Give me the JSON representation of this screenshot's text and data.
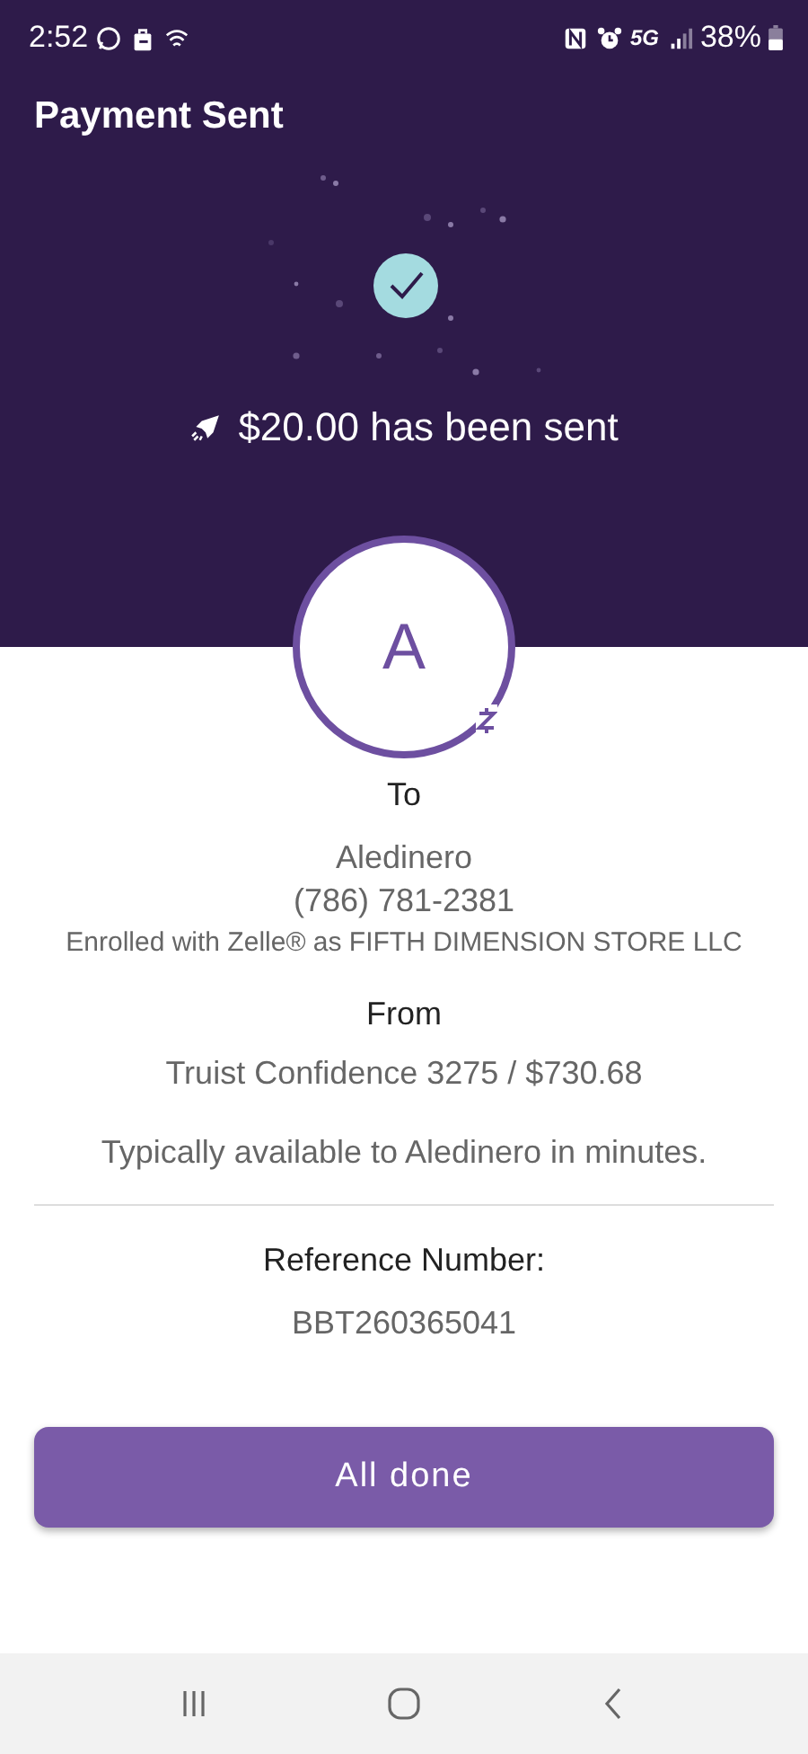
{
  "status_bar": {
    "time": "2:52",
    "network": "5G",
    "battery": "38%"
  },
  "header": {
    "title": "Payment Sent",
    "message": "$20.00 has been sent"
  },
  "recipient": {
    "initial": "A",
    "label": "To",
    "name": "Aledinero",
    "phone": "(786) 781-2381",
    "enrollment": "Enrolled with Zelle® as FIFTH DIMENSION STORE LLC"
  },
  "sender": {
    "label": "From",
    "account": "Truist Confidence 3275 / $730.68"
  },
  "availability": "Typically available to Aledinero in minutes.",
  "reference": {
    "label": "Reference Number:",
    "value": "BBT260365041"
  },
  "buttons": [
    {
      "label": "All done",
      "kind": "primary"
    }
  ]
}
